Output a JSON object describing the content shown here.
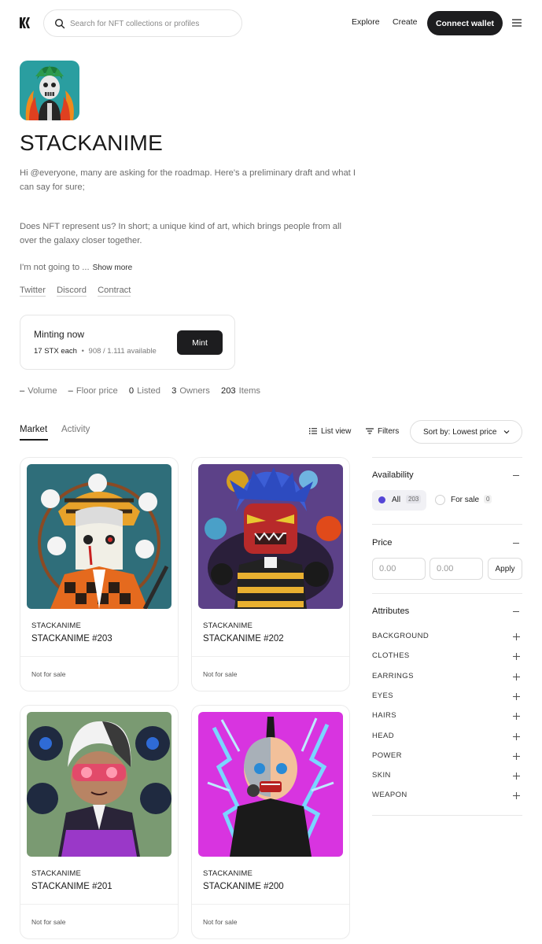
{
  "header": {
    "search_placeholder": "Search for NFT collections or profiles",
    "nav": [
      "Explore",
      "Create"
    ],
    "connect_label": "Connect wallet"
  },
  "collection": {
    "title": "STACKANIME",
    "desc_p1": "Hi @everyone, many are asking for the roadmap. Here's a preliminary draft and what I can say for sure;",
    "desc_p2": "Does NFT represent us? In short; a unique kind of art, which brings people from all over the galaxy closer together.",
    "desc_p3": "I'm not going to ...",
    "show_more": "Show more",
    "links": [
      "Twitter",
      "Discord",
      "Contract"
    ]
  },
  "mint": {
    "title": "Minting now",
    "price": "17 STX each",
    "dot": "•",
    "available": "908 / 1.111 available",
    "button": "Mint"
  },
  "stats": [
    {
      "value": "–",
      "label": "Volume"
    },
    {
      "value": "–",
      "label": "Floor price"
    },
    {
      "value": "0",
      "label": "Listed"
    },
    {
      "value": "3",
      "label": "Owners"
    },
    {
      "value": "203",
      "label": "Items"
    }
  ],
  "tabs": [
    "Market",
    "Activity"
  ],
  "toolbar": {
    "list_view": "List view",
    "filters": "Filters",
    "sort": "Sort by: Lowest price"
  },
  "items": [
    {
      "collection": "STACKANIME",
      "name": "STACKANIME #203",
      "status": "Not for sale"
    },
    {
      "collection": "STACKANIME",
      "name": "STACKANIME #202",
      "status": "Not for sale"
    },
    {
      "collection": "STACKANIME",
      "name": "STACKANIME #201",
      "status": "Not for sale"
    },
    {
      "collection": "STACKANIME",
      "name": "STACKANIME #200",
      "status": "Not for sale"
    }
  ],
  "filters": {
    "availability": {
      "title": "Availability",
      "all_label": "All",
      "all_count": "203",
      "sale_label": "For sale",
      "sale_count": "0"
    },
    "price": {
      "title": "Price",
      "min_placeholder": "0.00",
      "max_placeholder": "0.00",
      "apply": "Apply"
    },
    "attributes": {
      "title": "Attributes",
      "items": [
        "BACKGROUND",
        "CLOTHES",
        "EARRINGS",
        "EYES",
        "HAIRS",
        "HEAD",
        "POWER",
        "SKIN",
        "WEAPON"
      ]
    }
  },
  "colors": {
    "accent": "#5546d6",
    "button_dark": "#1d1d1f"
  },
  "icons": [
    "logo-icon",
    "search-icon",
    "menu-icon",
    "list-icon",
    "filter-icon",
    "chevron-down-icon",
    "minus-icon",
    "plus-icon"
  ]
}
